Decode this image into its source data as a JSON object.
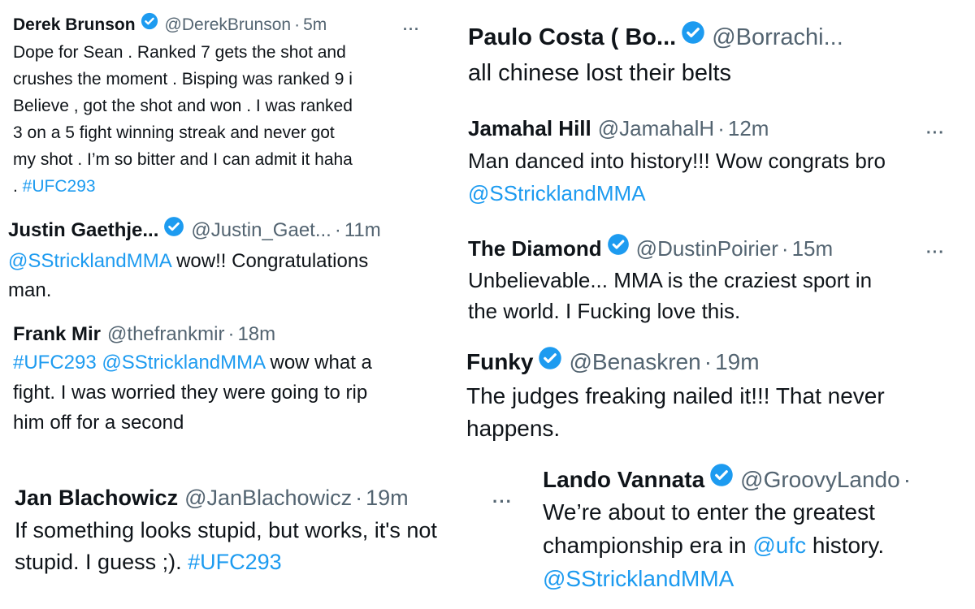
{
  "colors": {
    "text": "#0f1419",
    "muted": "#536471",
    "link": "#1d9bf0",
    "badge": "#1d9bf0"
  },
  "icons": {
    "verified": "verified-badge-icon",
    "more": "more-options-icon"
  },
  "tweets": [
    {
      "name": "Derek Brunson",
      "handle": "@DerekBrunson",
      "sep": "·",
      "time": "5m",
      "more": "···",
      "lines": [
        [
          {
            "t": "Dope for Sean . Ranked 7 gets the shot and"
          }
        ],
        [
          {
            "t": "crushes the moment . Bisping was ranked 9 i"
          }
        ],
        [
          {
            "t": "Believe , got the shot and won . I was ranked"
          }
        ],
        [
          {
            "t": "3 on a 5 fight winning streak and never got"
          }
        ],
        [
          {
            "t": "my shot . I’m so bitter and I can admit it haha"
          }
        ],
        [
          {
            "t": ". "
          },
          {
            "t": "#UFC293",
            "link": true
          }
        ]
      ]
    },
    {
      "name": "Justin Gaethje...",
      "handle": "@Justin_Gaet...",
      "sep": "·",
      "time": "11m",
      "lines": [
        [
          {
            "t": "@SStricklandMMA",
            "link": true
          },
          {
            "t": " wow!! Congratulations"
          }
        ],
        [
          {
            "t": "man."
          }
        ]
      ]
    },
    {
      "name": "Frank Mir",
      "handle": "@thefrankmir",
      "sep": "·",
      "time": "18m",
      "lines": [
        [
          {
            "t": "#UFC293",
            "link": true
          },
          {
            "t": " "
          },
          {
            "t": "@SStricklandMMA",
            "link": true
          },
          {
            "t": " wow what a"
          }
        ],
        [
          {
            "t": "fight.  I was worried they were going to rip"
          }
        ],
        [
          {
            "t": "him off for a second"
          }
        ]
      ]
    },
    {
      "name": "Jan Blachowicz",
      "handle": "@JanBlachowicz",
      "sep": "·",
      "time": "19m",
      "more": "···",
      "lines": [
        [
          {
            "t": "If something looks stupid, but works, it's not"
          }
        ],
        [
          {
            "t": "stupid. I guess ;). "
          },
          {
            "t": "#UFC293",
            "link": true
          }
        ]
      ]
    },
    {
      "name": "Paulo Costa ( Bo...",
      "handle": "@Borrachi...",
      "lines": [
        [
          {
            "t": "all chinese lost their belts"
          }
        ]
      ]
    },
    {
      "name": "Jamahal Hill",
      "handle": "@JamahalH",
      "sep": "·",
      "time": "12m",
      "more": "···",
      "lines": [
        [
          {
            "t": "Man danced into history!!! Wow congrats bro"
          }
        ],
        [
          {
            "t": "@SStricklandMMA",
            "link": true
          }
        ]
      ]
    },
    {
      "name": "The Diamond",
      "handle": "@DustinPoirier",
      "sep": "·",
      "time": "15m",
      "more": "···",
      "lines": [
        [
          {
            "t": "Unbelievable... MMA is the craziest sport in"
          }
        ],
        [
          {
            "t": "the world.  I Fucking love this."
          }
        ]
      ]
    },
    {
      "name": "Funky",
      "handle": "@Benaskren",
      "sep": "·",
      "time": "19m",
      "lines": [
        [
          {
            "t": "The judges freaking nailed it!!! That never"
          }
        ],
        [
          {
            "t": "happens."
          }
        ]
      ]
    },
    {
      "name": "Lando Vannata",
      "handle": "@GroovyLando",
      "sep": "·",
      "lines": [
        [
          {
            "t": "We’re about to enter the greatest"
          }
        ],
        [
          {
            "t": "championship era in "
          },
          {
            "t": "@ufc",
            "link": true
          },
          {
            "t": " history."
          }
        ],
        [
          {
            "t": "@SStricklandMMA",
            "link": true
          }
        ]
      ]
    }
  ]
}
